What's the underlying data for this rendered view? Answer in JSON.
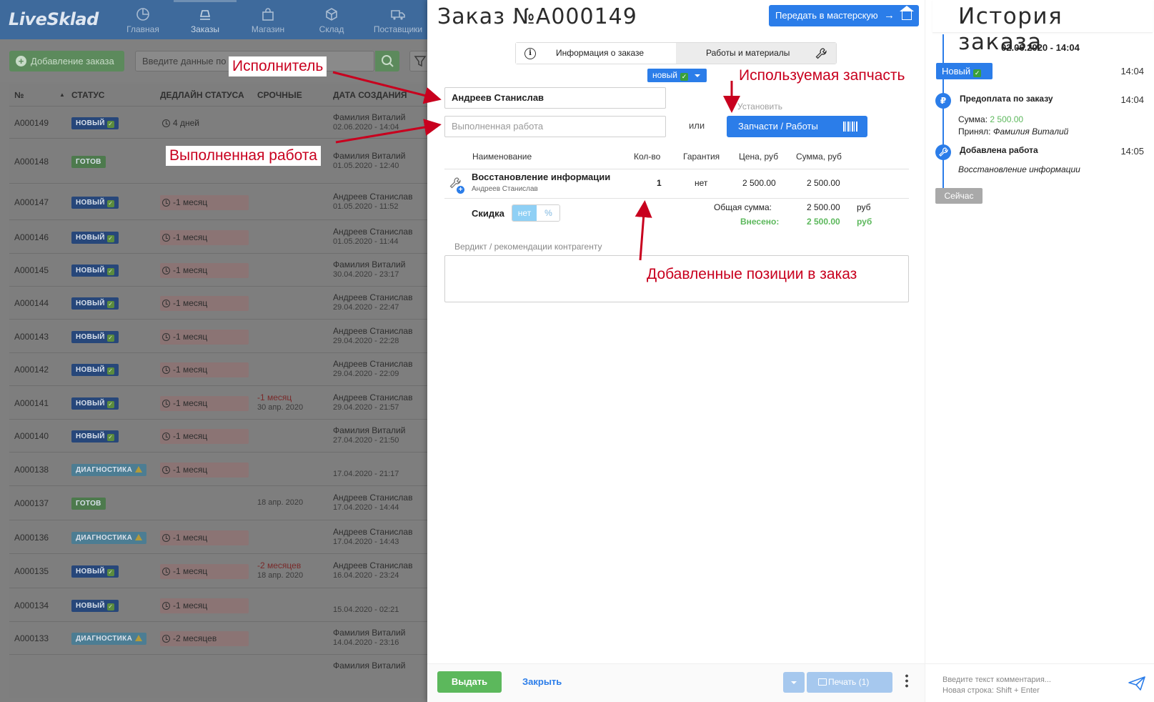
{
  "app": {
    "logo": "LiveSklad",
    "nav": [
      {
        "label": "Главная",
        "icon": "dashboard-icon"
      },
      {
        "label": "Заказы",
        "icon": "orders-icon"
      },
      {
        "label": "Магазин",
        "icon": "shop-bag-icon"
      },
      {
        "label": "Склад",
        "icon": "box-icon"
      },
      {
        "label": "Поставщики",
        "icon": "truck-icon"
      }
    ],
    "add_order": "Добавление заказа",
    "search_placeholder": "Введите данные по"
  },
  "orders_table": {
    "columns": [
      "№",
      "СТАТУС",
      "ДЕДЛАЙН СТАТУСА",
      "СРОЧНЫЕ",
      "ДАТА СОЗДАНИЯ"
    ],
    "rows": [
      {
        "id": "A000149",
        "status": "НОВЫЙ",
        "kind": "new",
        "deadline": "4 дней",
        "dl_plain": true,
        "urgent": "",
        "urgent_sub": "",
        "author": "Фамилия Виталий",
        "date": "02.06.2020 - 14:04"
      },
      {
        "id": "A000148",
        "status": "ГОТОВ",
        "kind": "ready",
        "deadline": "",
        "urgent": "",
        "urgent_sub": "",
        "author": "Фамилия Виталий",
        "date": "01.05.2020 - 12:40"
      },
      {
        "id": "A000147",
        "status": "НОВЫЙ",
        "kind": "new",
        "deadline": "-1 месяц",
        "urgent": "",
        "urgent_sub": "",
        "author": "Андреев Станислав",
        "date": "01.05.2020 - 11:52"
      },
      {
        "id": "A000146",
        "status": "НОВЫЙ",
        "kind": "new",
        "deadline": "-1 месяц",
        "urgent": "",
        "urgent_sub": "",
        "author": "Андреев Станислав",
        "date": "01.05.2020 - 11:44"
      },
      {
        "id": "A000145",
        "status": "НОВЫЙ",
        "kind": "new",
        "deadline": "-1 месяц",
        "urgent": "",
        "urgent_sub": "",
        "author": "Фамилия Виталий",
        "date": "30.04.2020 - 23:17"
      },
      {
        "id": "A000144",
        "status": "НОВЫЙ",
        "kind": "new",
        "deadline": "-1 месяц",
        "urgent": "",
        "urgent_sub": "",
        "author": "Андреев Станислав",
        "date": "29.04.2020 - 22:47"
      },
      {
        "id": "A000143",
        "status": "НОВЫЙ",
        "kind": "new",
        "deadline": "-1 месяц",
        "urgent": "",
        "urgent_sub": "",
        "author": "Андреев Станислав",
        "date": "29.04.2020 - 22:28"
      },
      {
        "id": "A000142",
        "status": "НОВЫЙ",
        "kind": "new",
        "deadline": "-1 месяц",
        "urgent": "",
        "urgent_sub": "",
        "author": "Андреев Станислав",
        "date": "29.04.2020 - 22:09"
      },
      {
        "id": "A000141",
        "status": "НОВЫЙ",
        "kind": "new",
        "deadline": "-1 месяц",
        "urgent": "-1 месяц",
        "urgent_sub": "30 апр. 2020",
        "author": "Андреев Станислав",
        "date": "29.04.2020 - 21:57"
      },
      {
        "id": "A000140",
        "status": "НОВЫЙ",
        "kind": "new",
        "deadline": "-1 месяц",
        "urgent": "",
        "urgent_sub": "",
        "author": "Фамилия Виталий",
        "date": "27.04.2020 - 21:50"
      },
      {
        "id": "A000138",
        "status": "ДИАГНОСТИКА",
        "kind": "diag",
        "deadline": "-1 месяц",
        "urgent": "",
        "urgent_sub": "",
        "author": "",
        "date": "17.04.2020 - 21:17"
      },
      {
        "id": "A000137",
        "status": "ГОТОВ",
        "kind": "ready",
        "deadline": "",
        "urgent": "",
        "urgent_sub": "18 апр. 2020",
        "author": "Андреев Станислав",
        "date": "17.04.2020 - 14:44"
      },
      {
        "id": "A000136",
        "status": "ДИАГНОСТИКА",
        "kind": "diag",
        "deadline": "-1 месяц",
        "urgent": "",
        "urgent_sub": "",
        "author": "Андреев Станислав",
        "date": "17.04.2020 - 14:43"
      },
      {
        "id": "A000135",
        "status": "НОВЫЙ",
        "kind": "new",
        "deadline": "-1 месяц",
        "urgent": "-2 месяцев",
        "urgent_sub": "18 апр. 2020",
        "author": "Андреев Станислав",
        "date": "16.04.2020 - 23:24"
      },
      {
        "id": "A000134",
        "status": "НОВЫЙ",
        "kind": "new",
        "deadline": "-1 месяц",
        "urgent": "",
        "urgent_sub": "",
        "author": "",
        "date": "15.04.2020 - 02:21"
      },
      {
        "id": "A000133",
        "status": "ДИАГНОСТИКА",
        "kind": "diag",
        "deadline": "-2 месяцев",
        "urgent": "",
        "urgent_sub": "",
        "author": "Фамилия Виталий",
        "date": "14.04.2020 - 23:16"
      },
      {
        "id": "",
        "status": "",
        "kind": "diag",
        "deadline": "",
        "urgent": "",
        "urgent_sub": "",
        "author": "Фамилия Виталий",
        "date": ""
      }
    ]
  },
  "order": {
    "title": "Заказ №A000149",
    "transfer_button": "Передать в мастерскую",
    "tabs": [
      "Информация о заказе",
      "Работы и материалы"
    ],
    "status": "новый",
    "executor": "Андреев Станислав",
    "work_placeholder": "Выполненная работа",
    "or": "или",
    "install_label": "Установить",
    "parts_button": "Запчасти / Работы",
    "items_header": [
      "Наименование",
      "Кол-во",
      "Гарантия",
      "Цена, руб",
      "Сумма, руб"
    ],
    "items": [
      {
        "name": "Восстановление информации",
        "executor": "Андреев Станислав",
        "qty": "1",
        "warranty": "нет",
        "price": "2 500.00",
        "sum": "2 500.00"
      }
    ],
    "total_label": "Общая сумма:",
    "total_value": "2 500.00",
    "currency": "руб",
    "paid_label": "Внесено:",
    "paid_value": "2 500.00",
    "discount_label": "Скидка",
    "discount_options": [
      "нет",
      "%"
    ],
    "verdict_label": "Вердикт / рекомендации контрагенту",
    "issue_button": "Выдать",
    "close_button": "Закрыть",
    "print_button": "Печать (1)"
  },
  "annotations": {
    "executor": "Исполнитель",
    "work": "Выполненная работа",
    "part": "Используемая запчасть",
    "positions": "Добавленные позиции в заказ"
  },
  "history": {
    "title": "История заказа",
    "date": "02.06.2020 - 14:04",
    "status": "Новый",
    "status_time": "14:04",
    "events": [
      {
        "title": "Предоплата по заказу",
        "time": "14:04",
        "sum_label": "Сумма:",
        "sum": "2 500.00",
        "accepted_label": "Принял:",
        "accepted_by": "Фамилия Виталий"
      },
      {
        "title": "Добавлена работа",
        "time": "14:05",
        "detail": "Восстановление информации"
      }
    ],
    "now": "Сейчас",
    "comment_placeholder": "Введите текст комментария...",
    "comment_hint": "Новая строка: Shift + Enter"
  },
  "colors": {
    "accent": "#2b7de9",
    "success": "#5cb85c",
    "annotation": "#c8001e"
  }
}
